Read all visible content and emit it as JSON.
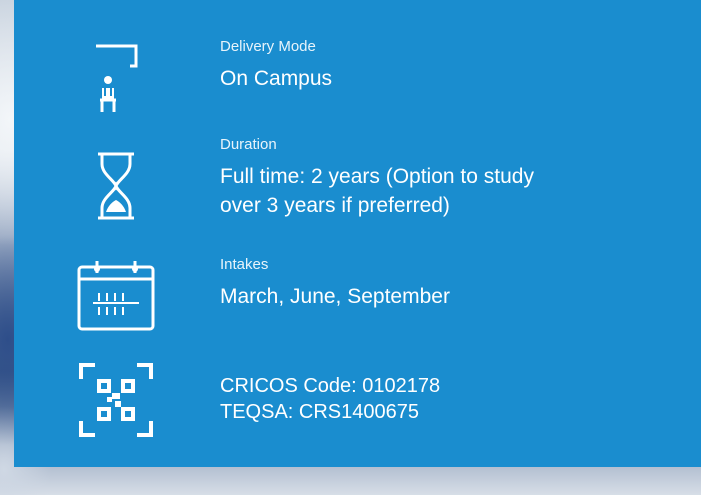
{
  "details": [
    {
      "icon": "classroom-seat-icon",
      "label": "Delivery Mode",
      "value_lines": [
        "On Campus"
      ]
    },
    {
      "icon": "hourglass-icon",
      "label": "Duration",
      "value_lines": [
        "Full time: 2 years (Option to study",
        "over 3 years if preferred)"
      ]
    },
    {
      "icon": "calendar-icon",
      "label": "Intakes",
      "value_lines": [
        "March, June, September"
      ]
    },
    {
      "icon": "qr-code-scan-icon",
      "label": "",
      "value_lines": [
        "CRICOS Code: 0102178",
        "TEQSA: CRS1400675"
      ]
    }
  ],
  "colors": {
    "panel": "#1a8dcf",
    "text": "#ffffff"
  }
}
